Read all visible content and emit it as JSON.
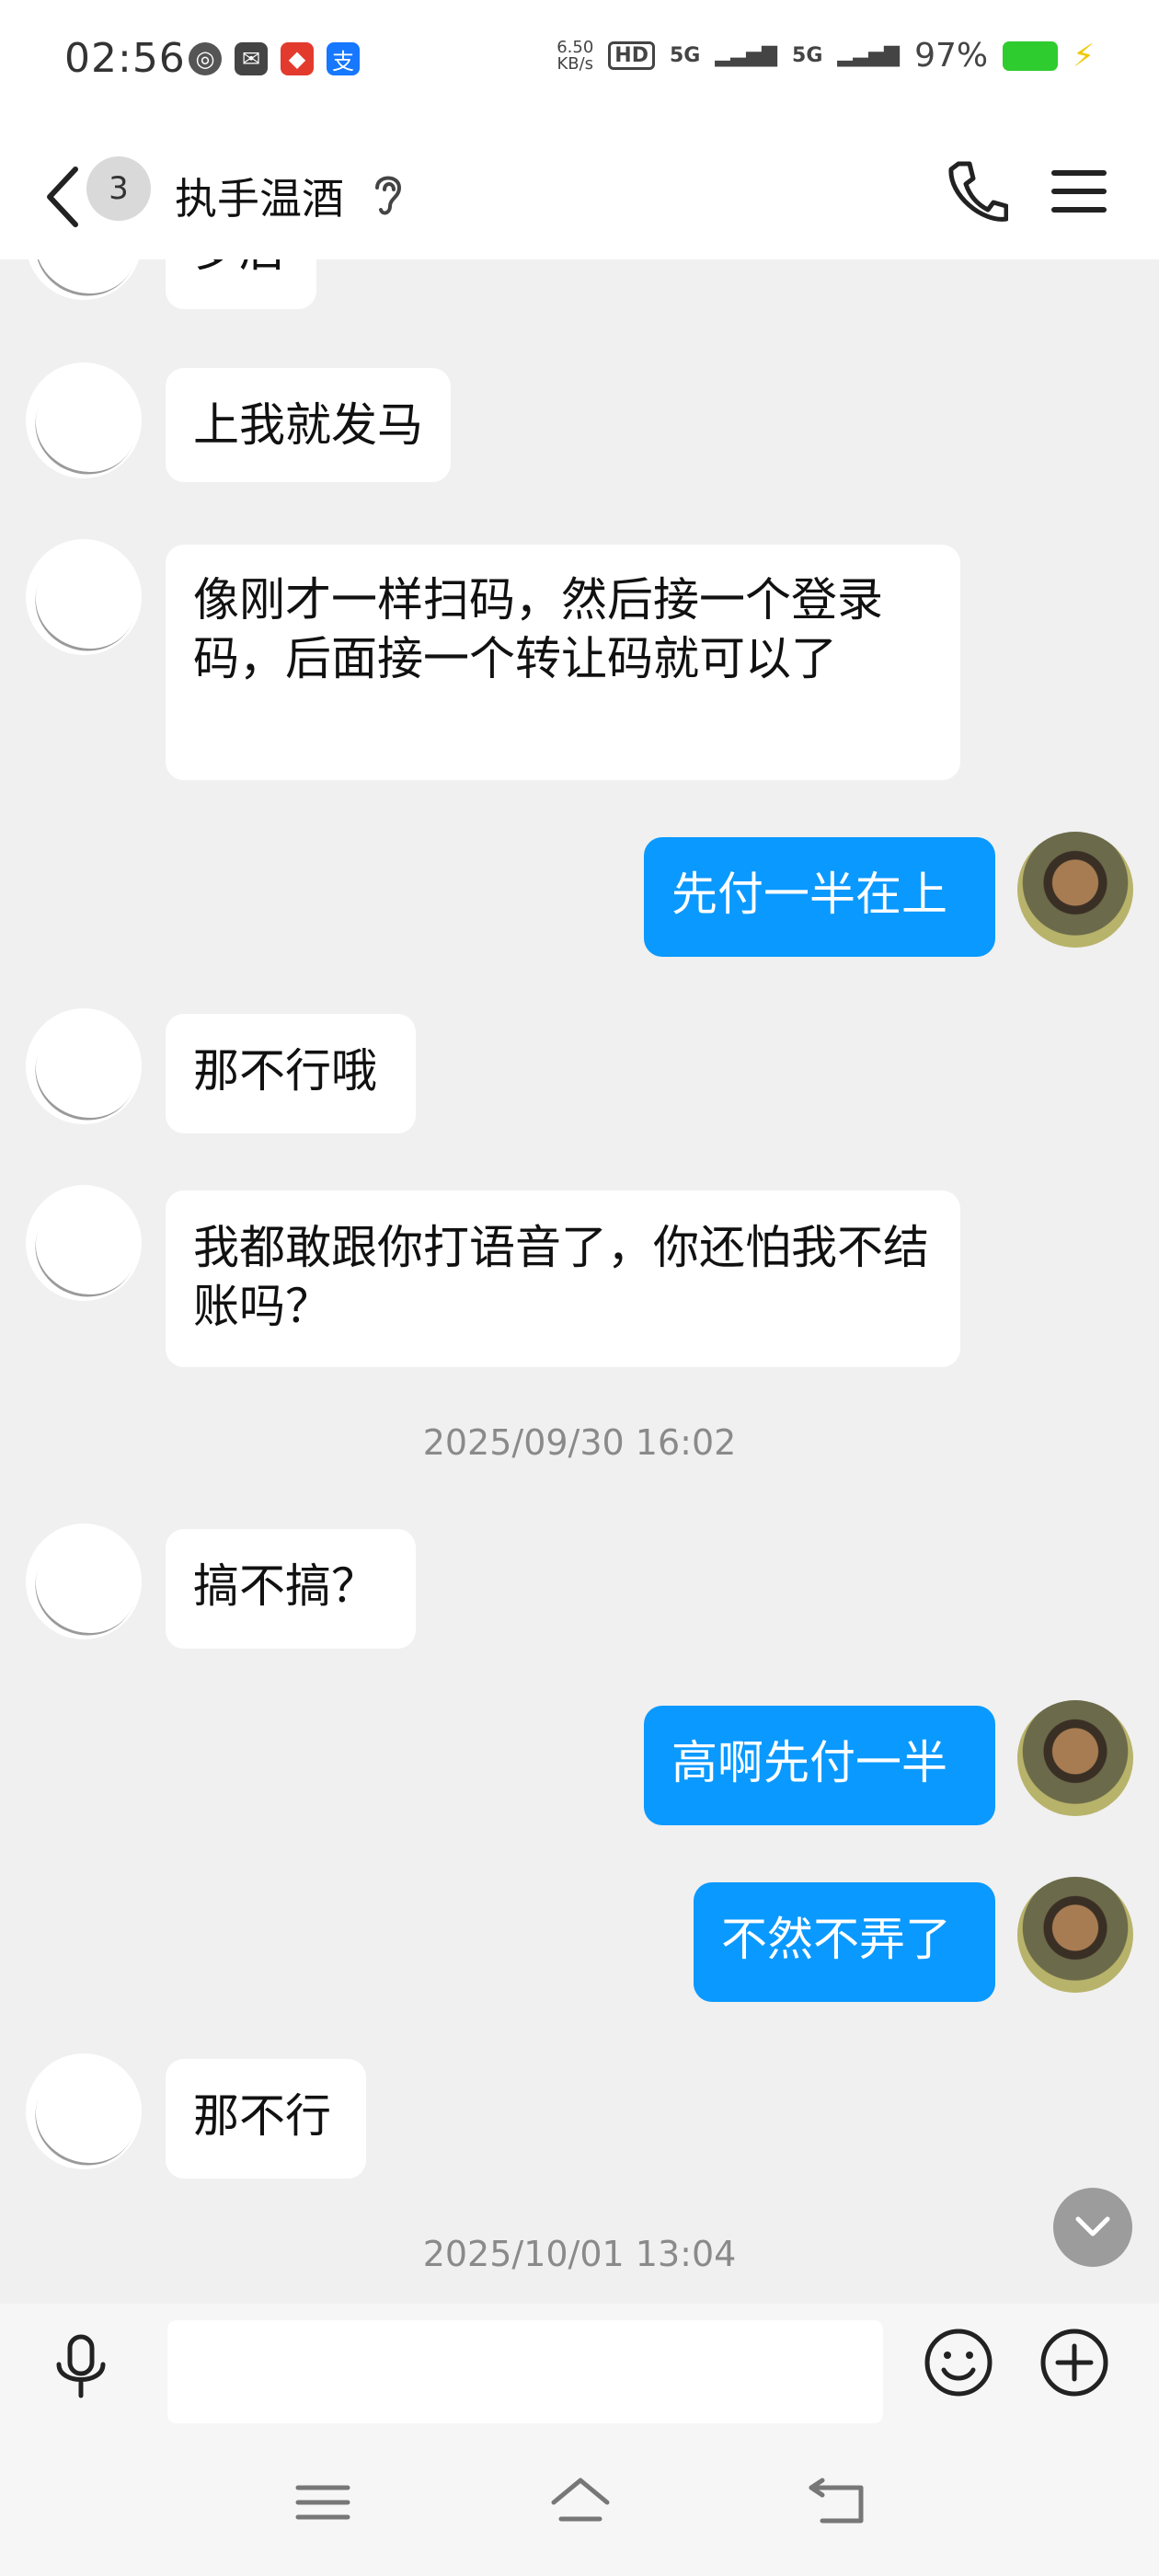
{
  "status_bar": {
    "time": "02:56",
    "net_speed_value": "6.50",
    "net_speed_unit": "KB/s",
    "hd_badge": "HD",
    "signal1": "5G",
    "signal2": "5G",
    "battery_percent": "97%"
  },
  "header": {
    "unread_count": "3",
    "title": "执手温酒",
    "icons": [
      "back-icon",
      "ear-icon",
      "phone-icon",
      "menu-icon"
    ]
  },
  "messages": {
    "m0": "岁后",
    "m1": "上我就发马",
    "m2": "像刚才一样扫码，然后接一个登录码，后面接一个转让码就可以了",
    "m3": "先付一半在上",
    "m4": "那不行哦",
    "m5": "我都敢跟你打语音了，你还怕我不结账吗？",
    "ts1": "2025/09/30 16:02",
    "m6": "搞不搞？",
    "m7": "高啊先付一半",
    "m8": "不然不弄了",
    "m9": "那不行",
    "ts2": "2025/10/01 13:04"
  },
  "input_bar": {
    "icons": [
      "microphone-icon",
      "emoji-icon",
      "plus-icon"
    ],
    "text_value": ""
  },
  "colors": {
    "outgoing_bubble": "#0a99ff",
    "incoming_bubble": "#ffffff",
    "background": "#f0f0f0"
  }
}
